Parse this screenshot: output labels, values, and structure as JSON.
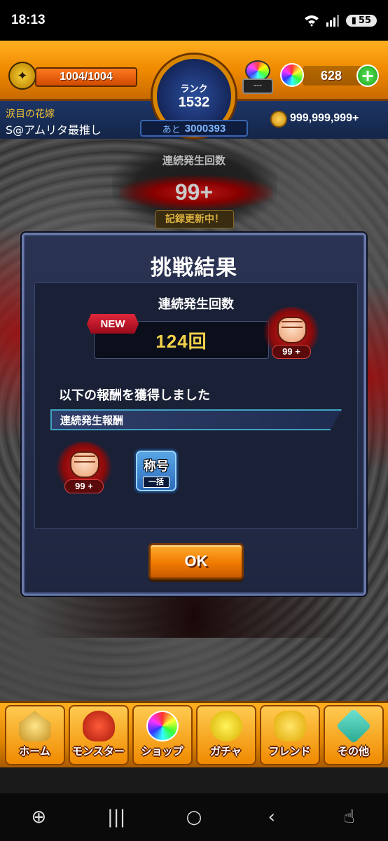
{
  "status_bar": {
    "time": "18:13",
    "battery": "55"
  },
  "header": {
    "stamina": "1004/1004",
    "rank_label": "ランク",
    "rank_value": "1532",
    "rank_next_label": "あと",
    "rank_next_value": "3000393",
    "dispenser_label": "---",
    "orb_count": "628",
    "player_title": "涙目の花嫁",
    "player_name": "S@アムリタ最推し",
    "coins": "999,999,999+"
  },
  "streak": {
    "label": "連続発生回数",
    "value": "99+",
    "record": "記録更新中！"
  },
  "modal": {
    "title": "挑戦結果",
    "subtitle": "連続発生回数",
    "new_badge": "NEW",
    "count": "124回",
    "fist_level": "99 +",
    "reward_text": "以下の報酬を獲得しました",
    "reward_category": "連続発生報酬",
    "reward_fist_level": "99 +",
    "title_item_kanji": "称号",
    "title_item_sub": "一括",
    "ok_label": "OK"
  },
  "bottom_nav": {
    "items": [
      {
        "label": "ホーム",
        "icon": "home-icon"
      },
      {
        "label": "モンスター",
        "icon": "monster-icon"
      },
      {
        "label": "ショップ",
        "icon": "shop-icon"
      },
      {
        "label": "ガチャ",
        "icon": "gacha-icon"
      },
      {
        "label": "フレンド",
        "icon": "friend-icon"
      },
      {
        "label": "その他",
        "icon": "other-icon"
      }
    ]
  },
  "system_nav": {
    "game_icon": "⊕",
    "recents": "|||",
    "home": "○",
    "back": "‹",
    "hand_icon": "☝"
  },
  "colors": {
    "accent_orange": "#f08a00",
    "header_blue": "#1d3566",
    "modal_bg": "#2a3352",
    "count_yellow": "#f2d24a",
    "new_red": "#e0283a"
  }
}
